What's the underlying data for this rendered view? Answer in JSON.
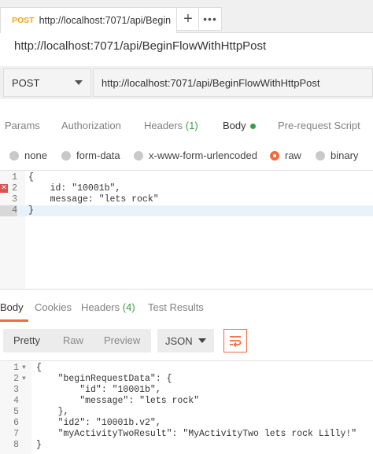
{
  "tab": {
    "method": "POST",
    "title": "http://localhost:7071/api/Begin",
    "add": "+",
    "more": "•••"
  },
  "request_name": "http://localhost:7071/api/BeginFlowWithHttpPost",
  "urlbar": {
    "method": "POST",
    "url": "http://localhost:7071/api/BeginFlowWithHttpPost"
  },
  "request_tabs": [
    {
      "label": "Params"
    },
    {
      "label": "Authorization"
    },
    {
      "label": "Headers",
      "count": "(1)"
    },
    {
      "label": "Body"
    },
    {
      "label": "Pre-request Script"
    }
  ],
  "body_types": [
    "none",
    "form-data",
    "x-www-form-urlencoded",
    "raw",
    "binary"
  ],
  "body_type_selected": "raw",
  "request_body": {
    "line_numbers": [
      "1",
      "2",
      "3",
      "4"
    ],
    "lines": [
      "{",
      "    id: \"10001b\",",
      "    message: \"lets rock\"",
      "}"
    ]
  },
  "response_tabs": [
    {
      "label": "Body"
    },
    {
      "label": "Cookies"
    },
    {
      "label": "Headers",
      "count": "(4)"
    },
    {
      "label": "Test Results"
    }
  ],
  "response_view": {
    "modes": [
      "Pretty",
      "Raw",
      "Preview"
    ],
    "format": "JSON"
  },
  "response_body": {
    "line_numbers": [
      "1",
      "2",
      "3",
      "4",
      "5",
      "6",
      "7",
      "8"
    ],
    "lines": [
      "{",
      "    \"beginRequestData\": {",
      "        \"id\": \"10001b\",",
      "        \"message\": \"lets rock\"",
      "    },",
      "    \"id2\": \"10001b.v2\",",
      "    \"myActivityTwoResult\": \"MyActivityTwo lets rock Lilly!\"",
      "}"
    ]
  },
  "colors": {
    "accent": "#f26b3a",
    "method_post": "#f5a623",
    "count_green": "#3a9e4a"
  }
}
